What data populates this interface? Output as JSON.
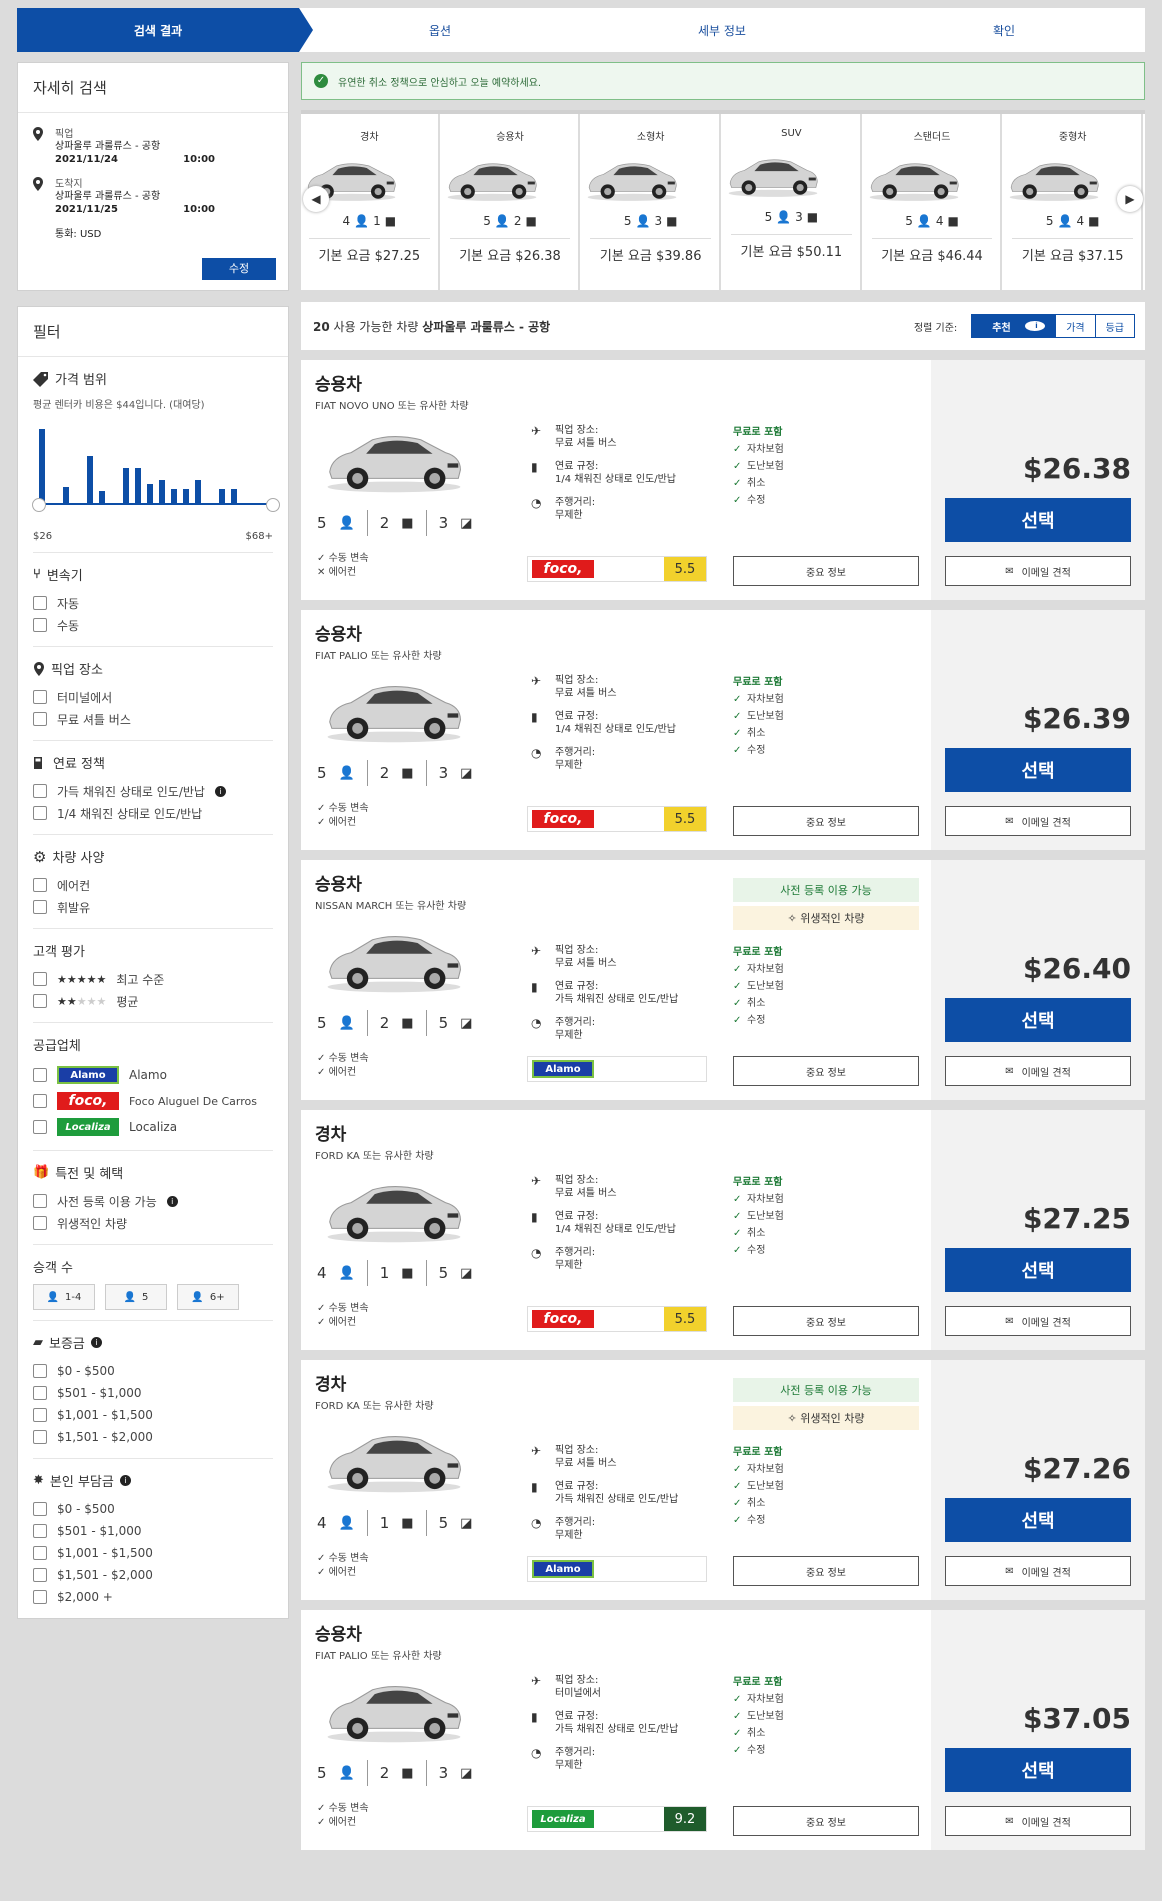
{
  "steps": [
    "검색 결과",
    "옵션",
    "세부 정보",
    "확인"
  ],
  "search": {
    "title": "자세히 검색",
    "pickup_label": "픽업",
    "pickup_loc": "상파울루 과룰류스 - 공항",
    "pickup_date": "2021/11/24",
    "pickup_time": "10:00",
    "drop_label": "도착지",
    "drop_loc": "상파울루 과룰류스 - 공항",
    "drop_date": "2021/11/25",
    "drop_time": "10:00",
    "currency": "통화: USD",
    "edit": "수정"
  },
  "filter": {
    "title": "필터",
    "price": {
      "title": "가격 범위",
      "note": "평균 렌터카 비용은 $44입니다. (대여당)",
      "min": "$26",
      "max": "$68+"
    },
    "trans": {
      "title": "변속기",
      "opts": [
        "자동",
        "수동"
      ]
    },
    "pickup": {
      "title": "픽업 장소",
      "opts": [
        "터미널에서",
        "무료 셔틀 버스"
      ]
    },
    "fuel": {
      "title": "연료 정책",
      "opts": [
        "가득 채워진 상태로 인도/반납",
        "1/4 채워진 상태로 인도/반납"
      ]
    },
    "spec": {
      "title": "차량 사양",
      "opts": [
        "에어컨",
        "휘발유"
      ]
    },
    "rating": {
      "title": "고객 평가",
      "opts": [
        "최고 수준",
        "평균"
      ],
      "stars": [
        "★★★★★",
        "★★"
      ]
    },
    "supplier": {
      "title": "공급업체",
      "opts": [
        "Alamo",
        "Foco Aluguel De Carros",
        "Localiza"
      ]
    },
    "perks": {
      "title": "특전 및 혜택",
      "opts": [
        "사전 등록 이용 가능",
        "위생적인 차량"
      ]
    },
    "pax": {
      "title": "승객 수",
      "opts": [
        "1-4",
        "5",
        "6+"
      ]
    },
    "deposit": {
      "title": "보증금",
      "opts": [
        "$0 - $500",
        "$501 - $1,000",
        "$1,001 - $1,500",
        "$1,501 - $2,000"
      ]
    },
    "excess": {
      "title": "본인 부담금",
      "opts": [
        "$0 - $500",
        "$501 - $1,000",
        "$1,001 - $1,500",
        "$1,501 - $2,000",
        "$2,000 +"
      ]
    }
  },
  "notice": "유연한 취소 정책으로 안심하고 오늘 예약하세요.",
  "categories": [
    {
      "name": "경차",
      "pax": "4",
      "bags": "1",
      "price": "기본 요금 $27.25"
    },
    {
      "name": "승용차",
      "pax": "5",
      "bags": "2",
      "price": "기본 요금 $26.38"
    },
    {
      "name": "소형차",
      "pax": "5",
      "bags": "3",
      "price": "기본 요금 $39.86"
    },
    {
      "name": "SUV",
      "pax": "5",
      "bags": "3",
      "price": "기본 요금 $50.11"
    },
    {
      "name": "스탠더드",
      "pax": "5",
      "bags": "4",
      "price": "기본 요금 $46.44"
    },
    {
      "name": "중형차",
      "pax": "5",
      "bags": "4",
      "price": "기본 요금 $37.15"
    }
  ],
  "results": {
    "count": "20",
    "text": "사용 가능한 차량",
    "loc": "상파울루 과룰류스 - 공항",
    "sort_label": "정렬 기준:",
    "sort": [
      "추천",
      "가격",
      "등급"
    ]
  },
  "cars": [
    {
      "name": "승용차",
      "sub": "FIAT NOVO UNO 또는 유사한 차량",
      "pax": "5",
      "bags": "2",
      "doors": "3",
      "trans": "수동 변속",
      "ac": "에어컨",
      "pickup_l": "픽업 장소:",
      "pickup": "무료 셔틀 버스",
      "fuel_l": "연료 규정:",
      "fuel": "1/4 채워진 상태로 인도/반납",
      "mile_l": "주행거리:",
      "mile": "무제한",
      "vendor": "foco",
      "score": "5.5",
      "price": "$26.38"
    },
    {
      "name": "승용차",
      "sub": "FIAT PALIO 또는 유사한 차량",
      "pax": "5",
      "bags": "2",
      "doors": "3",
      "trans": "수동 변속",
      "ac": "에어컨",
      "pickup_l": "픽업 장소:",
      "pickup": "무료 셔틀 버스",
      "fuel_l": "연료 규정:",
      "fuel": "1/4 채워진 상태로 인도/반납",
      "mile_l": "주행거리:",
      "mile": "무제한",
      "vendor": "foco",
      "score": "5.5",
      "price": "$26.39"
    },
    {
      "name": "승용차",
      "sub": "NISSAN MARCH 또는 유사한 차량",
      "pax": "5",
      "bags": "2",
      "doors": "5",
      "trans": "수동 변속",
      "ac": "에어컨",
      "pickup_l": "픽업 장소:",
      "pickup": "무료 셔틀 버스",
      "fuel_l": "연료 규정:",
      "fuel": "가득 채워진 상태로 인도/반납",
      "mile_l": "주행거리:",
      "mile": "무제한",
      "vendor": "Alamo",
      "score": "",
      "price": "$26.40",
      "badge1": "사전 등록 이용 가능",
      "badge2": "위생적인 차량"
    },
    {
      "name": "경차",
      "sub": "FORD KA 또는 유사한 차량",
      "pax": "4",
      "bags": "1",
      "doors": "5",
      "trans": "수동 변속",
      "ac": "에어컨",
      "pickup_l": "픽업 장소:",
      "pickup": "무료 셔틀 버스",
      "fuel_l": "연료 규정:",
      "fuel": "1/4 채워진 상태로 인도/반납",
      "mile_l": "주행거리:",
      "mile": "무제한",
      "vendor": "foco",
      "score": "5.5",
      "price": "$27.25"
    },
    {
      "name": "경차",
      "sub": "FORD KA 또는 유사한 차량",
      "pax": "4",
      "bags": "1",
      "doors": "5",
      "trans": "수동 변속",
      "ac": "에어컨",
      "pickup_l": "픽업 장소:",
      "pickup": "무료 셔틀 버스",
      "fuel_l": "연료 규정:",
      "fuel": "가득 채워진 상태로 인도/반납",
      "mile_l": "주행거리:",
      "mile": "무제한",
      "vendor": "Alamo",
      "score": "",
      "price": "$27.26",
      "badge1": "사전 등록 이용 가능",
      "badge2": "위생적인 차량"
    },
    {
      "name": "승용차",
      "sub": "FIAT PALIO 또는 유사한 차량",
      "pax": "5",
      "bags": "2",
      "doors": "3",
      "trans": "수동 변속",
      "ac": "에어컨",
      "pickup_l": "픽업 장소:",
      "pickup": "터미널에서",
      "fuel_l": "연료 규정:",
      "fuel": "가득 채워진 상태로 인도/반납",
      "mile_l": "주행거리:",
      "mile": "무제한",
      "vendor": "Localiza",
      "score": "9.2",
      "price": "$37.05"
    }
  ],
  "included": {
    "title": "무료로 포함",
    "items": [
      "자차보험",
      "도난보험",
      "취소",
      "수정"
    ]
  },
  "labels": {
    "select": "선택",
    "details": "중요 정보",
    "email": "이메일 견적"
  },
  "price_hist": [
    0.95,
    0,
    0.2,
    0,
    0.6,
    0.15,
    0,
    0.45,
    0.45,
    0.25,
    0.3,
    0.18,
    0.18,
    0.3,
    0,
    0.18,
    0.18
  ],
  "colors": {
    "primary": "#0d4ea6",
    "green": "#1d7a36",
    "score": "#f2d12c"
  }
}
